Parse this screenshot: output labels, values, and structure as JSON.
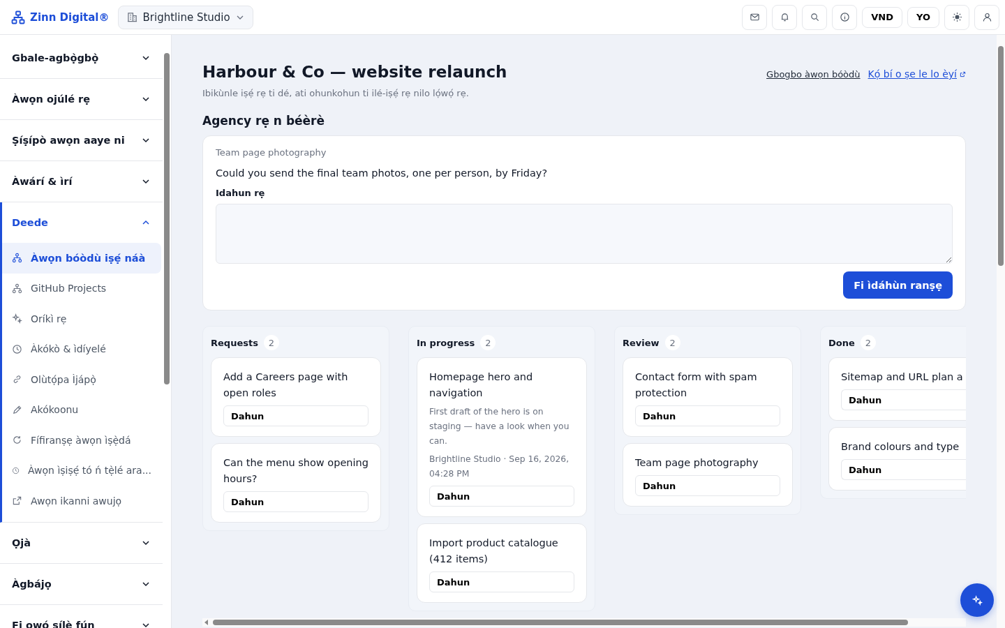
{
  "header": {
    "brand": "Zinn Digital®",
    "workspace": "Brightline Studio",
    "actions": [
      {
        "kind": "icon"
      },
      {
        "kind": "icon"
      },
      {
        "kind": "icon"
      },
      {
        "kind": "icon"
      },
      {
        "kind": "text",
        "label": "VND"
      },
      {
        "kind": "text",
        "label": "YO"
      },
      {
        "kind": "icon"
      },
      {
        "kind": "icon"
      }
    ]
  },
  "sidebar": {
    "sections": [
      {
        "label": "Gbale-agbọ̀gbọ̀",
        "expanded": false
      },
      {
        "label": "Àwọn ojúlé rẹ",
        "expanded": false
      },
      {
        "label": "Ṣíṣípò awọn aaye ni",
        "expanded": false
      },
      {
        "label": "Àwárí & ìrí",
        "expanded": false
      },
      {
        "label": "Deede",
        "expanded": true,
        "items": [
          {
            "label": "Àwọn bóòdù iṣẹ́ náà",
            "selected": true
          },
          {
            "label": "GitHub Projects",
            "selected": false
          },
          {
            "label": "Oríkì rẹ",
            "selected": false
          },
          {
            "label": "Àkókò & ìdíyelé",
            "selected": false
          },
          {
            "label": "Olùtọ́pa Ìjápọ̀",
            "selected": false
          },
          {
            "label": "Akókoonu",
            "selected": false
          },
          {
            "label": "Fífiranṣẹ àwọn ìṣẹ̀dá",
            "selected": false
          },
          {
            "label": "Àwọn ìṣiṣẹ́ tó ń tẹ̀lé ara...",
            "selected": false
          },
          {
            "label": "Awọn ikanni awujọ",
            "selected": false
          }
        ]
      },
      {
        "label": "Ọjà",
        "expanded": false
      },
      {
        "label": "Àgbájọ",
        "expanded": false
      },
      {
        "label": "Fi owó sílè fún",
        "expanded": false
      }
    ]
  },
  "page": {
    "title": "Harbour & Co — website relaunch",
    "subtitle": "Ibikùnle iṣẹ́ rẹ ti dé, ati ohunkohun ti ilé-iṣẹ́ rẹ nilo lọ́wọ́ rẹ.",
    "links": [
      {
        "label": "Gbogbo àwọn bóòdù",
        "kind": "plain"
      },
      {
        "label": "Kọ́ bí o ṣe le lo èyí",
        "kind": "external"
      }
    ]
  },
  "request": {
    "heading": "Agency rẹ n béèrè",
    "topic": "Team page photography",
    "question": "Could you send the final team photos, one per person, by Friday?",
    "answer_label": "Idahun rẹ",
    "submit": "Fi ìdáhùn ranṣẹ"
  },
  "board": {
    "columns": [
      {
        "title": "Requests",
        "count": "2",
        "cards": [
          {
            "title": "Add a Careers page with open roles",
            "action": "Dahun"
          },
          {
            "title": "Can the menu show opening hours?",
            "action": "Dahun"
          }
        ]
      },
      {
        "title": "In progress",
        "count": "2",
        "cards": [
          {
            "title": "Homepage hero and navigation",
            "note": "First draft of the hero is on staging — have a look when you can.",
            "meta": "Brightline Studio · Sep 16, 2026, 04:28 PM",
            "action": "Dahun"
          },
          {
            "title": "Import product catalogue (412 items)",
            "action": "Dahun"
          }
        ]
      },
      {
        "title": "Review",
        "count": "2",
        "cards": [
          {
            "title": "Contact form with spam protection",
            "action": "Dahun"
          },
          {
            "title": "Team page photography",
            "action": "Dahun"
          }
        ]
      },
      {
        "title": "Done",
        "count": "2",
        "cards": [
          {
            "title": "Sitemap and URL plan a",
            "action": "Dahun"
          },
          {
            "title": "Brand colours and type",
            "action": "Dahun"
          }
        ]
      }
    ]
  }
}
